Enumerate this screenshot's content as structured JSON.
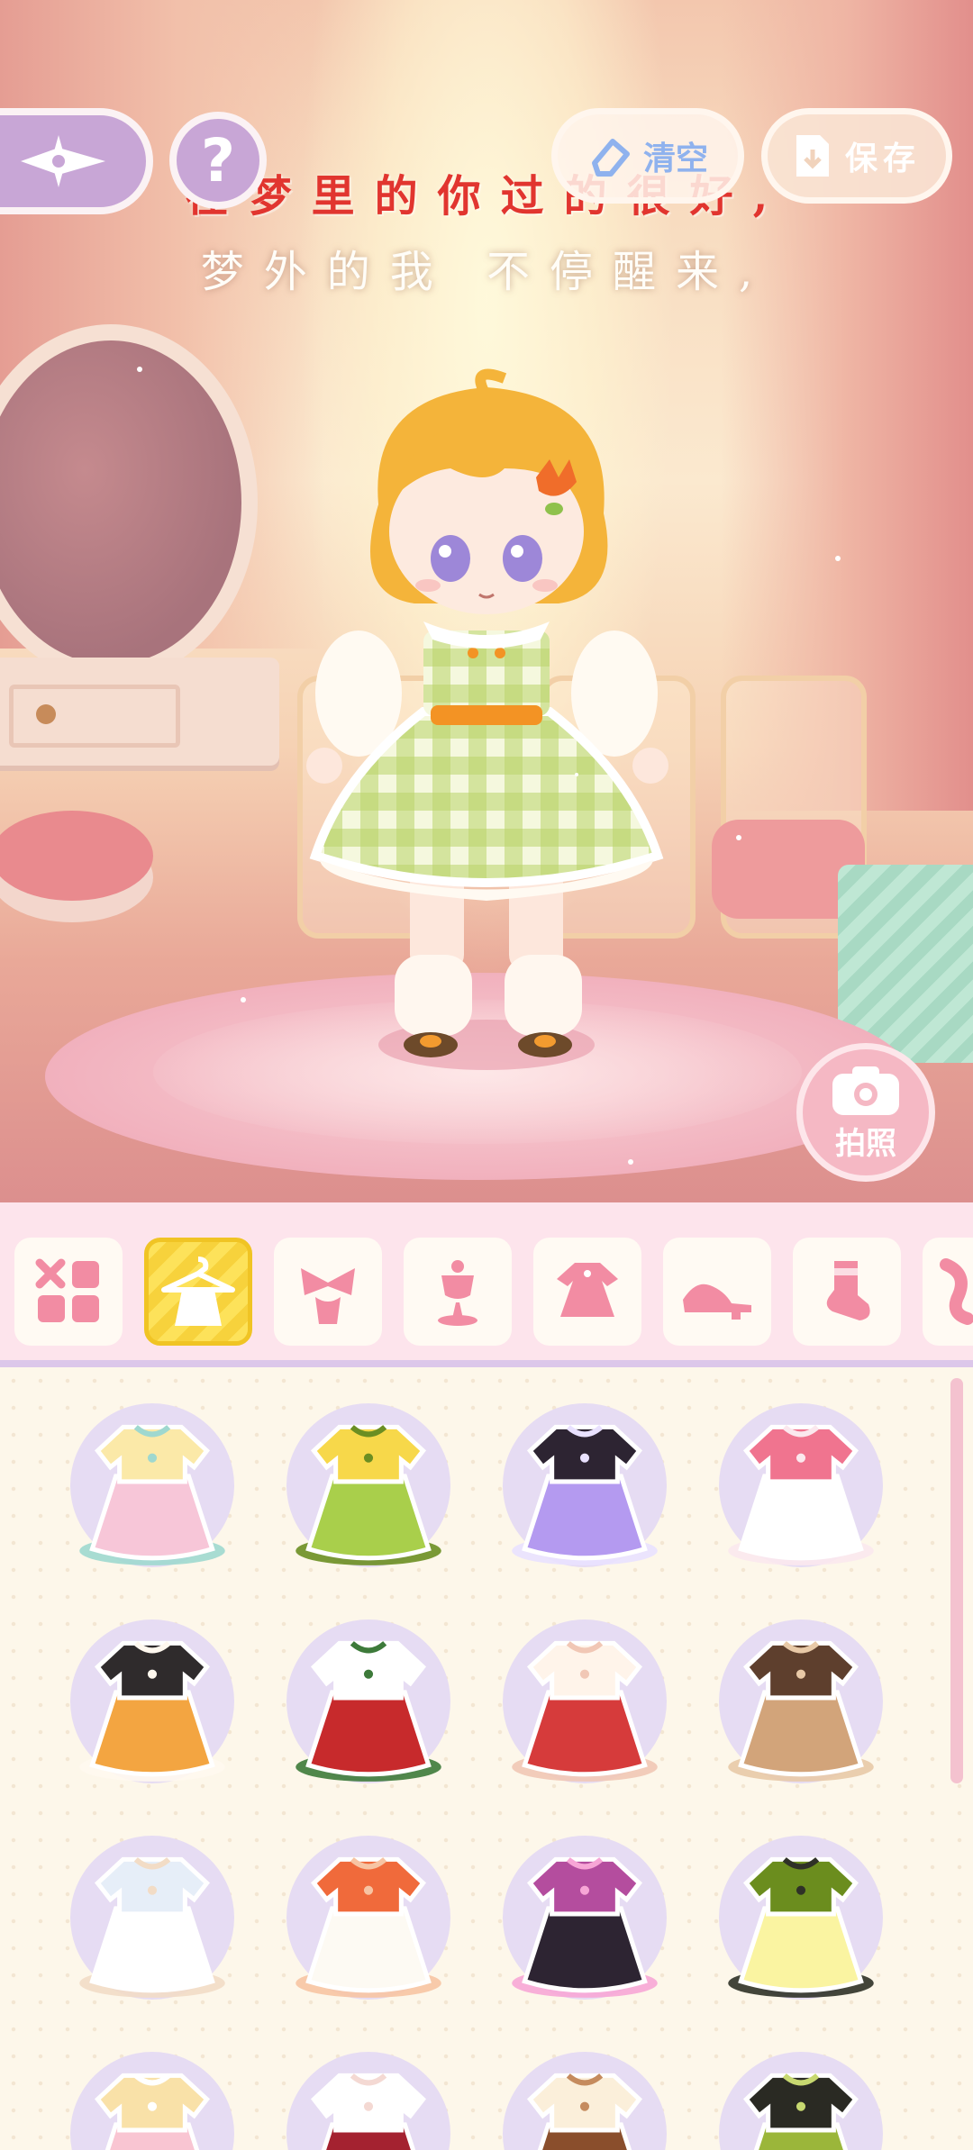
{
  "lyrics": {
    "line1": "在梦里的你过的很好,",
    "line2": "梦外的我 不停醒来,"
  },
  "toolbar": {
    "help_label": "?",
    "clear_label": "清空",
    "save_label": "保存"
  },
  "camera": {
    "label": "拍照"
  },
  "categories": [
    {
      "icon": "all-grid-icon",
      "active": false
    },
    {
      "icon": "dress-hanger-icon",
      "active": true
    },
    {
      "icon": "hair-bow-icon",
      "active": false
    },
    {
      "icon": "top-icon",
      "active": false
    },
    {
      "icon": "dress-icon",
      "active": false
    },
    {
      "icon": "shoes-icon",
      "active": false
    },
    {
      "icon": "socks-icon",
      "active": false
    },
    {
      "icon": "accessory-icon",
      "active": false
    }
  ],
  "outfits": [
    {
      "name": "pastel-pink-dress-outfit",
      "colors": [
        "#f7c6d8",
        "#fbe9a8",
        "#9fd8cf"
      ]
    },
    {
      "name": "green-yellow-overall-dress-outfit",
      "colors": [
        "#a9cf4b",
        "#f7d84a",
        "#6b8e22"
      ]
    },
    {
      "name": "purple-cat-shirt-black-shorts-outfit",
      "colors": [
        "#b49af0",
        "#2d2432",
        "#e9e1ff"
      ]
    },
    {
      "name": "white-pink-sleeve-dress-outfit",
      "colors": [
        "#ffffff",
        "#f0748f",
        "#fbe8ee"
      ]
    },
    {
      "name": "orange-black-bow-outfit",
      "colors": [
        "#f3a541",
        "#2f2b2c",
        "#fff8ef"
      ]
    },
    {
      "name": "red-christmas-dress-outfit",
      "colors": [
        "#c72a2c",
        "#ffffff",
        "#3d7a3a"
      ]
    },
    {
      "name": "red-bunny-fur-dress-outfit",
      "colors": [
        "#d63b3b",
        "#fff4ea",
        "#f1c7b5"
      ]
    },
    {
      "name": "beige-trench-coat-outfit",
      "colors": [
        "#d2a47a",
        "#5e3f2d",
        "#e8c9a7"
      ]
    },
    {
      "name": "white-lace-gown-outfit",
      "colors": [
        "#ffffff",
        "#e6eef8",
        "#f2dcc6"
      ]
    },
    {
      "name": "white-orange-qipao-outfit",
      "colors": [
        "#fdfaf3",
        "#f06a3b",
        "#f7c4a3"
      ]
    },
    {
      "name": "black-pink-music-outfit",
      "colors": [
        "#2d2432",
        "#b44d9e",
        "#f7a6d6"
      ]
    },
    {
      "name": "yellow-cat-shirt-green-skirt-outfit",
      "colors": [
        "#faf4a1",
        "#6b8d1e",
        "#2f3127"
      ]
    },
    {
      "name": "floral-pink-bear-dress-outfit",
      "colors": [
        "#f9c5d2",
        "#f9e1a8",
        "#ffffff"
      ]
    },
    {
      "name": "burgundy-white-ruffle-outfit",
      "colors": [
        "#a42230",
        "#ffffff",
        "#f4d9d3"
      ]
    },
    {
      "name": "brown-cream-ruffle-outfit",
      "colors": [
        "#8a4e2c",
        "#fbefda",
        "#c58b5e"
      ]
    },
    {
      "name": "olive-black-ruffle-outfit",
      "colors": [
        "#9bb63a",
        "#2a2a23",
        "#c7d870"
      ]
    }
  ]
}
